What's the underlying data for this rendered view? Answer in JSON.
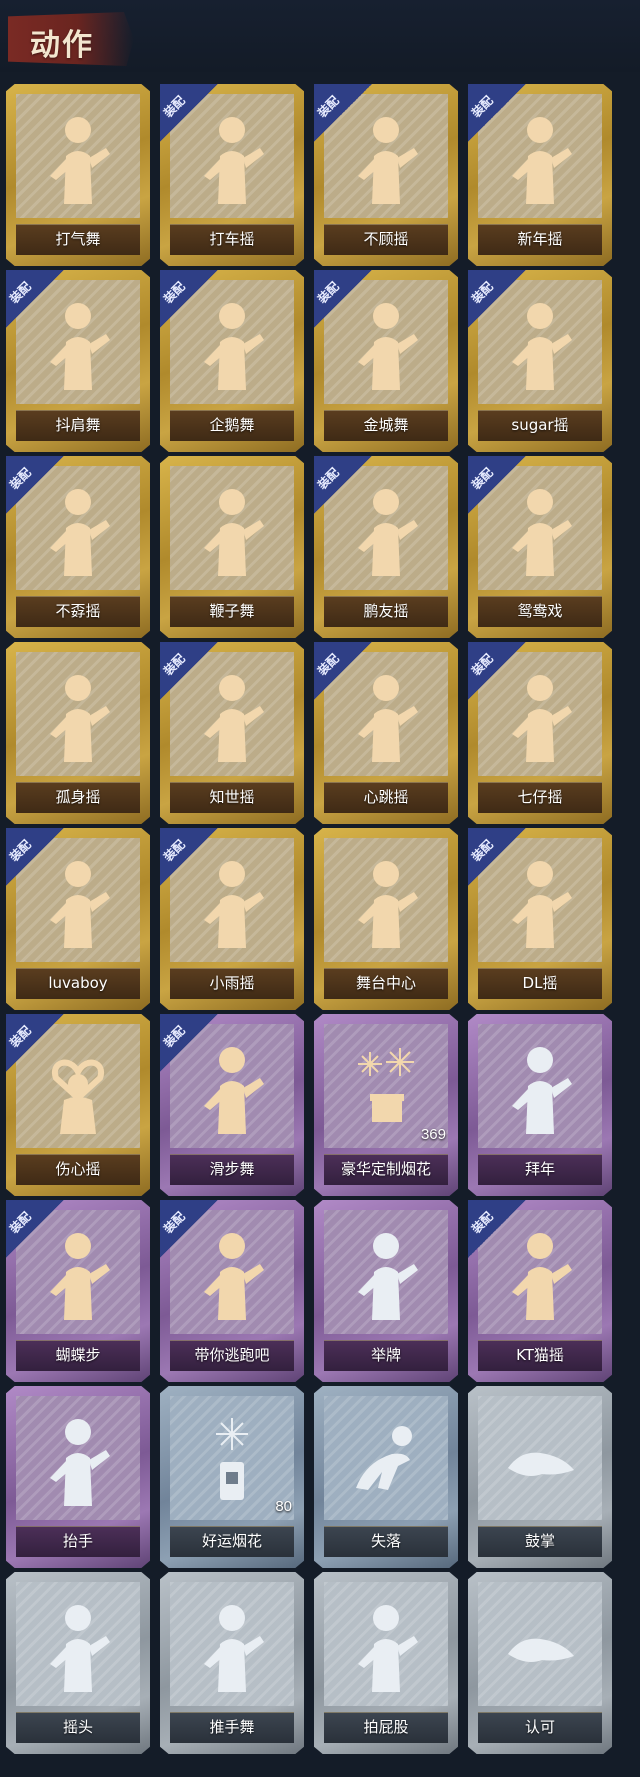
{
  "header": {
    "title": "动作"
  },
  "badge_text": "装配",
  "colors": {
    "gold_frame": "#c9a443",
    "purple_frame": "#9c78b3",
    "gray_frame": "#a7afb6",
    "badge_blue": "#2f3f86",
    "figure_gold": "#f2d7ad",
    "figure_silver": "#e9eef3"
  },
  "cards": [
    {
      "label": "打气舞",
      "tier": "gold",
      "equipped": false,
      "icon": "dance-figure-icon"
    },
    {
      "label": "打车摇",
      "tier": "gold",
      "equipped": true,
      "icon": "dance-figure-icon"
    },
    {
      "label": "不顾摇",
      "tier": "gold",
      "equipped": true,
      "icon": "dance-figure-icon"
    },
    {
      "label": "新年摇",
      "tier": "gold",
      "equipped": true,
      "icon": "dance-figure-icon"
    },
    {
      "label": "抖肩舞",
      "tier": "gold",
      "equipped": true,
      "icon": "dance-figure-icon"
    },
    {
      "label": "企鹅舞",
      "tier": "gold",
      "equipped": true,
      "icon": "dance-figure-icon"
    },
    {
      "label": "金城舞",
      "tier": "gold",
      "equipped": true,
      "icon": "dance-figure-icon"
    },
    {
      "label": "sugar摇",
      "tier": "gold",
      "equipped": true,
      "icon": "dance-figure-icon"
    },
    {
      "label": "不孬摇",
      "tier": "gold",
      "equipped": true,
      "icon": "dance-figure-icon"
    },
    {
      "label": "鞭子舞",
      "tier": "gold",
      "equipped": false,
      "icon": "dance-figure-icon"
    },
    {
      "label": "鹏友摇",
      "tier": "gold",
      "equipped": true,
      "icon": "dance-figure-icon"
    },
    {
      "label": "鸳鸯戏",
      "tier": "gold",
      "equipped": true,
      "icon": "dance-figure-icon"
    },
    {
      "label": "孤身摇",
      "tier": "gold",
      "equipped": false,
      "icon": "dance-figure-icon"
    },
    {
      "label": "知世摇",
      "tier": "gold",
      "equipped": true,
      "icon": "dance-figure-icon"
    },
    {
      "label": "心跳摇",
      "tier": "gold",
      "equipped": true,
      "icon": "dance-figure-icon"
    },
    {
      "label": "七仔摇",
      "tier": "gold",
      "equipped": true,
      "icon": "dance-figure-icon"
    },
    {
      "label": "luvaboy",
      "tier": "gold",
      "equipped": true,
      "icon": "dance-figure-icon"
    },
    {
      "label": "小雨摇",
      "tier": "gold",
      "equipped": true,
      "icon": "dance-figure-icon"
    },
    {
      "label": "舞台中心",
      "tier": "gold",
      "equipped": false,
      "icon": "dance-figure-icon"
    },
    {
      "label": "DL摇",
      "tier": "gold",
      "equipped": true,
      "icon": "dance-figure-icon"
    },
    {
      "label": "伤心摇",
      "tier": "gold",
      "equipped": true,
      "icon": "heart-hands-icon"
    },
    {
      "label": "滑步舞",
      "tier": "purple",
      "equipped": true,
      "icon": "dance-figure-icon"
    },
    {
      "label": "豪华定制烟花",
      "tier": "purple",
      "equipped": false,
      "icon": "fireworks-box-icon",
      "count": "369"
    },
    {
      "label": "拜年",
      "tier": "purple",
      "equipped": false,
      "icon": "bow-figure-icon",
      "silver": true
    },
    {
      "label": "蝴蝶步",
      "tier": "purple",
      "equipped": true,
      "icon": "dance-figure-icon"
    },
    {
      "label": "带你逃跑吧",
      "tier": "purple",
      "equipped": true,
      "icon": "dance-figure-icon"
    },
    {
      "label": "举牌",
      "tier": "purple",
      "equipped": false,
      "icon": "sign-figure-icon",
      "silver": true
    },
    {
      "label": "KT猫摇",
      "tier": "purple",
      "equipped": true,
      "icon": "dance-figure-icon"
    },
    {
      "label": "抬手",
      "tier": "purple",
      "equipped": false,
      "icon": "raise-hand-icon",
      "silver": true
    },
    {
      "label": "好运烟花",
      "tier": "blue",
      "equipped": false,
      "icon": "fireworks-can-icon",
      "silver": true,
      "count": "80"
    },
    {
      "label": "失落",
      "tier": "blue",
      "equipped": false,
      "icon": "crawl-figure-icon",
      "silver": true
    },
    {
      "label": "鼓掌",
      "tier": "gray",
      "equipped": false,
      "icon": "clap-hands-icon",
      "silver": true
    },
    {
      "label": "摇头",
      "tier": "gray",
      "equipped": false,
      "icon": "shake-head-icon",
      "silver": true
    },
    {
      "label": "推手舞",
      "tier": "gray",
      "equipped": false,
      "icon": "push-hands-icon",
      "silver": true
    },
    {
      "label": "拍屁股",
      "tier": "gray",
      "equipped": false,
      "icon": "pat-figure-icon",
      "silver": true
    },
    {
      "label": "认可",
      "tier": "gray",
      "equipped": false,
      "icon": "thumbs-up-icon",
      "silver": true
    }
  ]
}
